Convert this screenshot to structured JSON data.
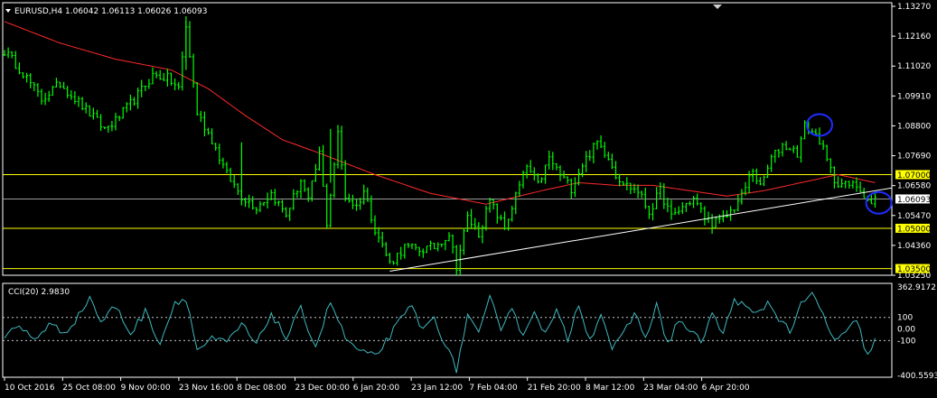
{
  "header": {
    "symbol": "EURUSD,H4",
    "ohlc": "1.06042 1.06113 1.06026 1.06093",
    "indicator": "CCI(20) 2.9830"
  },
  "colors": {
    "background": "#000000",
    "price": "#00ff00",
    "ma": "#ff2a2a",
    "cci": "#3fb8bf",
    "hline": "#ffff00",
    "trendline": "#ffffff",
    "circle": "#1e2cff",
    "label_bg": "#ffff00"
  },
  "chart_data": [
    {
      "type": "line",
      "name": "main-price-chart",
      "ylim": [
        1.0325,
        1.1327
      ],
      "y_ticks": [
        "1.13270",
        "1.12160",
        "1.11020",
        "1.09910",
        "1.08800",
        "1.07690",
        "1.06580",
        "1.05470",
        "1.04360",
        "1.03250"
      ],
      "x_ticks": [
        "10 Oct 2016",
        "25 Oct 08:00",
        "9 Nov 00:00",
        "23 Nov 16:00",
        "8 Dec 08:00",
        "23 Dec 00:00",
        "6 Jan 20:00",
        "23 Jan 12:00",
        "7 Feb 04:00",
        "21 Feb 20:00",
        "8 Mar 12:00",
        "23 Mar 04:00",
        "6 Apr 20:00"
      ],
      "price_keypoints": [
        [
          0,
          1.116
        ],
        [
          5,
          1.108
        ],
        [
          10,
          1.098
        ],
        [
          15,
          1.104
        ],
        [
          20,
          1.097
        ],
        [
          27,
          1.087
        ],
        [
          30,
          1.09
        ],
        [
          35,
          1.098
        ],
        [
          40,
          1.107
        ],
        [
          44,
          1.106
        ],
        [
          47,
          1.102
        ],
        [
          49,
          1.125
        ],
        [
          52,
          1.093
        ],
        [
          56,
          1.083
        ],
        [
          60,
          1.07
        ],
        [
          64,
          1.062
        ],
        [
          68,
          1.058
        ],
        [
          72,
          1.063
        ],
        [
          76,
          1.055
        ],
        [
          80,
          1.068
        ],
        [
          82,
          1.06
        ],
        [
          85,
          1.078
        ],
        [
          87,
          1.052
        ],
        [
          90,
          1.085
        ],
        [
          92,
          1.062
        ],
        [
          95,
          1.058
        ],
        [
          97,
          1.064
        ],
        [
          100,
          1.05
        ],
        [
          104,
          1.037
        ],
        [
          108,
          1.043
        ],
        [
          112,
          1.042
        ],
        [
          116,
          1.043
        ],
        [
          120,
          1.048
        ],
        [
          122,
          1.036
        ],
        [
          125,
          1.054
        ],
        [
          128,
          1.048
        ],
        [
          131,
          1.06
        ],
        [
          135,
          1.05
        ],
        [
          138,
          1.062
        ],
        [
          141,
          1.073
        ],
        [
          144,
          1.066
        ],
        [
          147,
          1.076
        ],
        [
          150,
          1.07
        ],
        [
          153,
          1.065
        ],
        [
          156,
          1.074
        ],
        [
          160,
          1.082
        ],
        [
          163,
          1.077
        ],
        [
          165,
          1.07
        ],
        [
          168,
          1.066
        ],
        [
          171,
          1.064
        ],
        [
          174,
          1.056
        ],
        [
          177,
          1.064
        ],
        [
          180,
          1.054
        ],
        [
          183,
          1.058
        ],
        [
          186,
          1.061
        ],
        [
          189,
          1.054
        ],
        [
          191,
          1.052
        ],
        [
          194,
          1.053
        ],
        [
          197,
          1.058
        ],
        [
          199,
          1.062
        ],
        [
          202,
          1.072
        ],
        [
          204,
          1.065
        ],
        [
          207,
          1.076
        ],
        [
          210,
          1.081
        ],
        [
          212,
          1.08
        ],
        [
          214,
          1.078
        ],
        [
          216,
          1.088
        ],
        [
          218,
          1.086
        ],
        [
          220,
          1.083
        ],
        [
          222,
          1.075
        ],
        [
          224,
          1.068
        ],
        [
          227,
          1.066
        ],
        [
          230,
          1.066
        ],
        [
          232,
          1.063
        ],
        [
          234,
          1.059
        ],
        [
          235,
          1.061
        ]
      ],
      "ma_keypoints": [
        [
          0,
          1.127
        ],
        [
          15,
          1.119
        ],
        [
          30,
          1.113
        ],
        [
          45,
          1.109
        ],
        [
          55,
          1.102
        ],
        [
          65,
          1.092
        ],
        [
          75,
          1.083
        ],
        [
          85,
          1.078
        ],
        [
          100,
          1.07
        ],
        [
          115,
          1.063
        ],
        [
          130,
          1.059
        ],
        [
          145,
          1.064
        ],
        [
          155,
          1.067
        ],
        [
          165,
          1.066
        ],
        [
          175,
          1.066
        ],
        [
          185,
          1.064
        ],
        [
          195,
          1.062
        ],
        [
          205,
          1.064
        ],
        [
          215,
          1.067
        ],
        [
          225,
          1.07
        ],
        [
          235,
          1.067
        ]
      ],
      "bar_count": 236,
      "horizontal_lines": [
        {
          "value": 1.07,
          "label": "1.07000"
        },
        {
          "value": 1.05,
          "label": "1.05000"
        },
        {
          "value": 1.035,
          "label": "1.03500"
        }
      ],
      "current_price": {
        "value": 1.06093,
        "label": "1.06093"
      },
      "trendline": {
        "from": [
          104,
          1.034
        ],
        "to": [
          273,
          1.0727
        ]
      },
      "circles": [
        [
          220,
          1.0885
        ],
        [
          236,
          1.0595
        ]
      ]
    },
    {
      "type": "line",
      "name": "cci-panel",
      "ylim": [
        -400.5593,
        362.9172
      ],
      "y_ticks": [
        "362.9172",
        "100",
        "0.00",
        "-100",
        "-400.5593"
      ],
      "levels": [
        100,
        -100
      ],
      "keypoints": [
        [
          0,
          -60
        ],
        [
          4,
          20
        ],
        [
          8,
          -90
        ],
        [
          12,
          40
        ],
        [
          16,
          -30
        ],
        [
          20,
          110
        ],
        [
          23,
          280
        ],
        [
          26,
          60
        ],
        [
          30,
          200
        ],
        [
          34,
          -40
        ],
        [
          38,
          150
        ],
        [
          42,
          -120
        ],
        [
          46,
          230
        ],
        [
          49,
          270
        ],
        [
          52,
          -180
        ],
        [
          56,
          -90
        ],
        [
          60,
          -120
        ],
        [
          64,
          40
        ],
        [
          68,
          -140
        ],
        [
          72,
          140
        ],
        [
          76,
          -80
        ],
        [
          80,
          170
        ],
        [
          84,
          -150
        ],
        [
          88,
          240
        ],
        [
          92,
          -80
        ],
        [
          96,
          -200
        ],
        [
          100,
          -240
        ],
        [
          104,
          -60
        ],
        [
          107,
          80
        ],
        [
          110,
          200
        ],
        [
          113,
          -20
        ],
        [
          116,
          110
        ],
        [
          119,
          -140
        ],
        [
          122,
          -350
        ],
        [
          125,
          120
        ],
        [
          128,
          -60
        ],
        [
          131,
          260
        ],
        [
          134,
          20
        ],
        [
          137,
          200
        ],
        [
          140,
          -80
        ],
        [
          143,
          180
        ],
        [
          146,
          -50
        ],
        [
          149,
          150
        ],
        [
          152,
          -90
        ],
        [
          155,
          230
        ],
        [
          158,
          -100
        ],
        [
          161,
          150
        ],
        [
          164,
          -170
        ],
        [
          167,
          -60
        ],
        [
          170,
          140
        ],
        [
          173,
          -70
        ],
        [
          176,
          200
        ],
        [
          179,
          -130
        ],
        [
          182,
          80
        ],
        [
          185,
          -20
        ],
        [
          188,
          -110
        ],
        [
          191,
          130
        ],
        [
          194,
          -50
        ],
        [
          197,
          270
        ],
        [
          200,
          180
        ],
        [
          203,
          120
        ],
        [
          206,
          230
        ],
        [
          209,
          100
        ],
        [
          212,
          -20
        ],
        [
          215,
          200
        ],
        [
          218,
          300
        ],
        [
          221,
          120
        ],
        [
          224,
          -100
        ],
        [
          227,
          -50
        ],
        [
          230,
          80
        ],
        [
          233,
          -240
        ],
        [
          236,
          0
        ]
      ]
    }
  ]
}
